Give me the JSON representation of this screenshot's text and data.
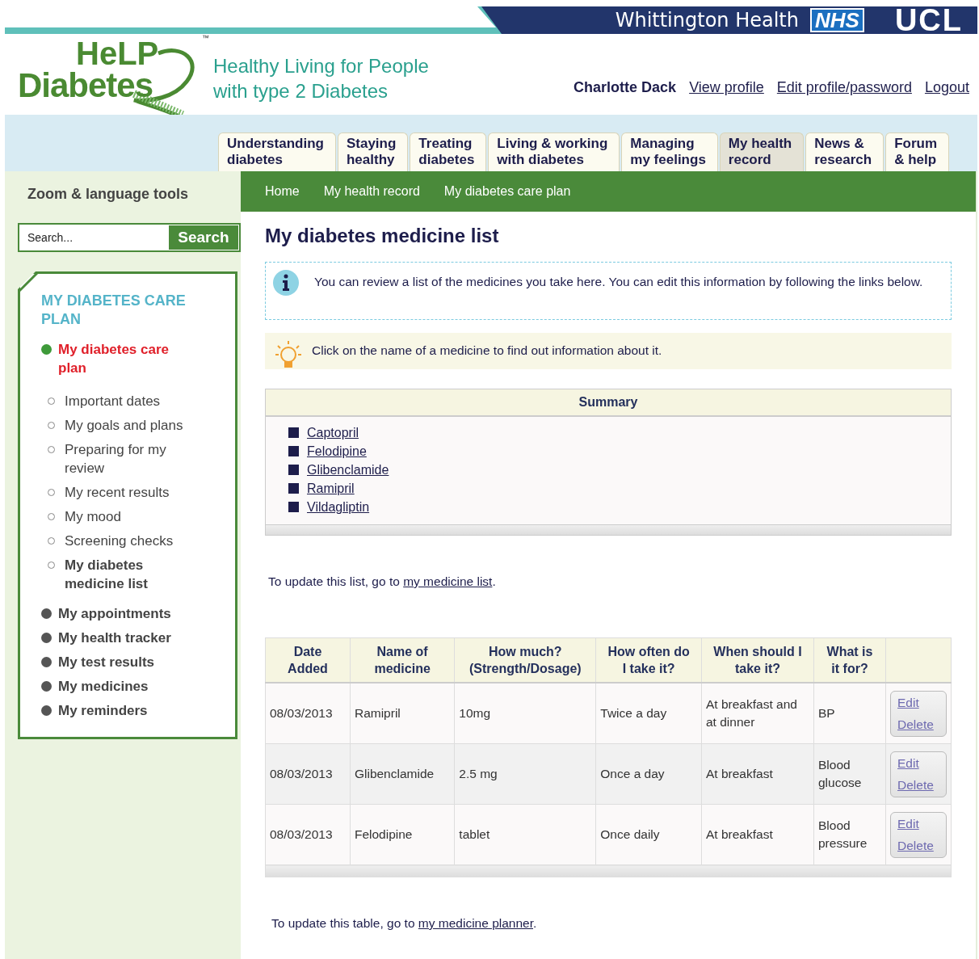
{
  "banner": {
    "org": "Whittington Health",
    "nhs": "NHS",
    "ucl": "UCL"
  },
  "logo": {
    "line1": "HeLP",
    "line2": "Diabetes",
    "tm": "™"
  },
  "tagline": [
    "Healthy Living for People",
    "with type 2 Diabetes"
  ],
  "user": {
    "name": "Charlotte Dack",
    "links": [
      "View profile",
      "Edit profile/password",
      "Logout"
    ]
  },
  "tabs": [
    {
      "label": "Understanding\ndiabetes",
      "selected": false
    },
    {
      "label": "Staying\nhealthy",
      "selected": false
    },
    {
      "label": "Treating\ndiabetes",
      "selected": false
    },
    {
      "label": "Living & working\nwith diabetes",
      "selected": false
    },
    {
      "label": "Managing\nmy feelings",
      "selected": false
    },
    {
      "label": "My health\nrecord",
      "selected": true
    },
    {
      "label": "News &\nresearch",
      "selected": false
    },
    {
      "label": "Forum\n& help",
      "selected": false
    }
  ],
  "sidebar": {
    "tools": "Zoom & language tools",
    "search": {
      "placeholder": "Search...",
      "button": "Search"
    },
    "heading": "MY DIABETES CARE PLAN",
    "items": [
      {
        "label": "My diabetes care plan",
        "selected": true,
        "children": [
          {
            "label": "Important dates",
            "selected": false
          },
          {
            "label": "My goals and plans",
            "selected": false
          },
          {
            "label": "Preparing for my review",
            "selected": false
          },
          {
            "label": "My recent results",
            "selected": false
          },
          {
            "label": "My mood",
            "selected": false
          },
          {
            "label": "Screening checks",
            "selected": false
          },
          {
            "label": "My diabetes medicine list",
            "selected": true
          }
        ]
      },
      {
        "label": "My appointments",
        "selected": false
      },
      {
        "label": "My health tracker",
        "selected": false
      },
      {
        "label": "My test results",
        "selected": false
      },
      {
        "label": "My medicines",
        "selected": false
      },
      {
        "label": "My reminders",
        "selected": false
      }
    ]
  },
  "breadcrumbs": [
    "Home",
    "My health record",
    "My diabetes care plan"
  ],
  "title": "My diabetes medicine list",
  "info": "You can review a list of the medicines you take here. You can edit this information by following the links below.",
  "tip": "Click on the name of a medicine to find out information about it.",
  "summary": {
    "heading": "Summary",
    "items": [
      "Captopril",
      "Felodipine",
      "Glibenclamide",
      "Ramipril",
      "Vildagliptin"
    ]
  },
  "update_list": {
    "before": "To update this list, go to ",
    "link": "my medicine list",
    "after": "."
  },
  "table": {
    "columns": [
      "Date\nAdded",
      "Name of\nmedicine",
      "How much?\n(Strength/Dosage)",
      "How often do\nI take it?",
      "When should I\ntake it?",
      "What is\nit for?"
    ],
    "rows": [
      {
        "cells": [
          "08/03/2013",
          "Ramipril",
          "10mg",
          "Twice a day",
          "At breakfast and at dinner",
          "BP"
        ],
        "actions": [
          "Edit",
          "Delete"
        ]
      },
      {
        "cells": [
          "08/03/2013",
          "Glibenclamide",
          "2.5 mg",
          "Once a day",
          "At breakfast",
          "Blood glucose"
        ],
        "actions": [
          "Edit",
          "Delete"
        ]
      },
      {
        "cells": [
          "08/03/2013",
          "Felodipine",
          "tablet",
          "Once daily",
          "At breakfast",
          "Blood pressure"
        ],
        "actions": [
          "Edit",
          "Delete"
        ]
      }
    ]
  },
  "update_table": {
    "before": "To update this table, go to ",
    "link": "my medicine planner",
    "after": "."
  }
}
